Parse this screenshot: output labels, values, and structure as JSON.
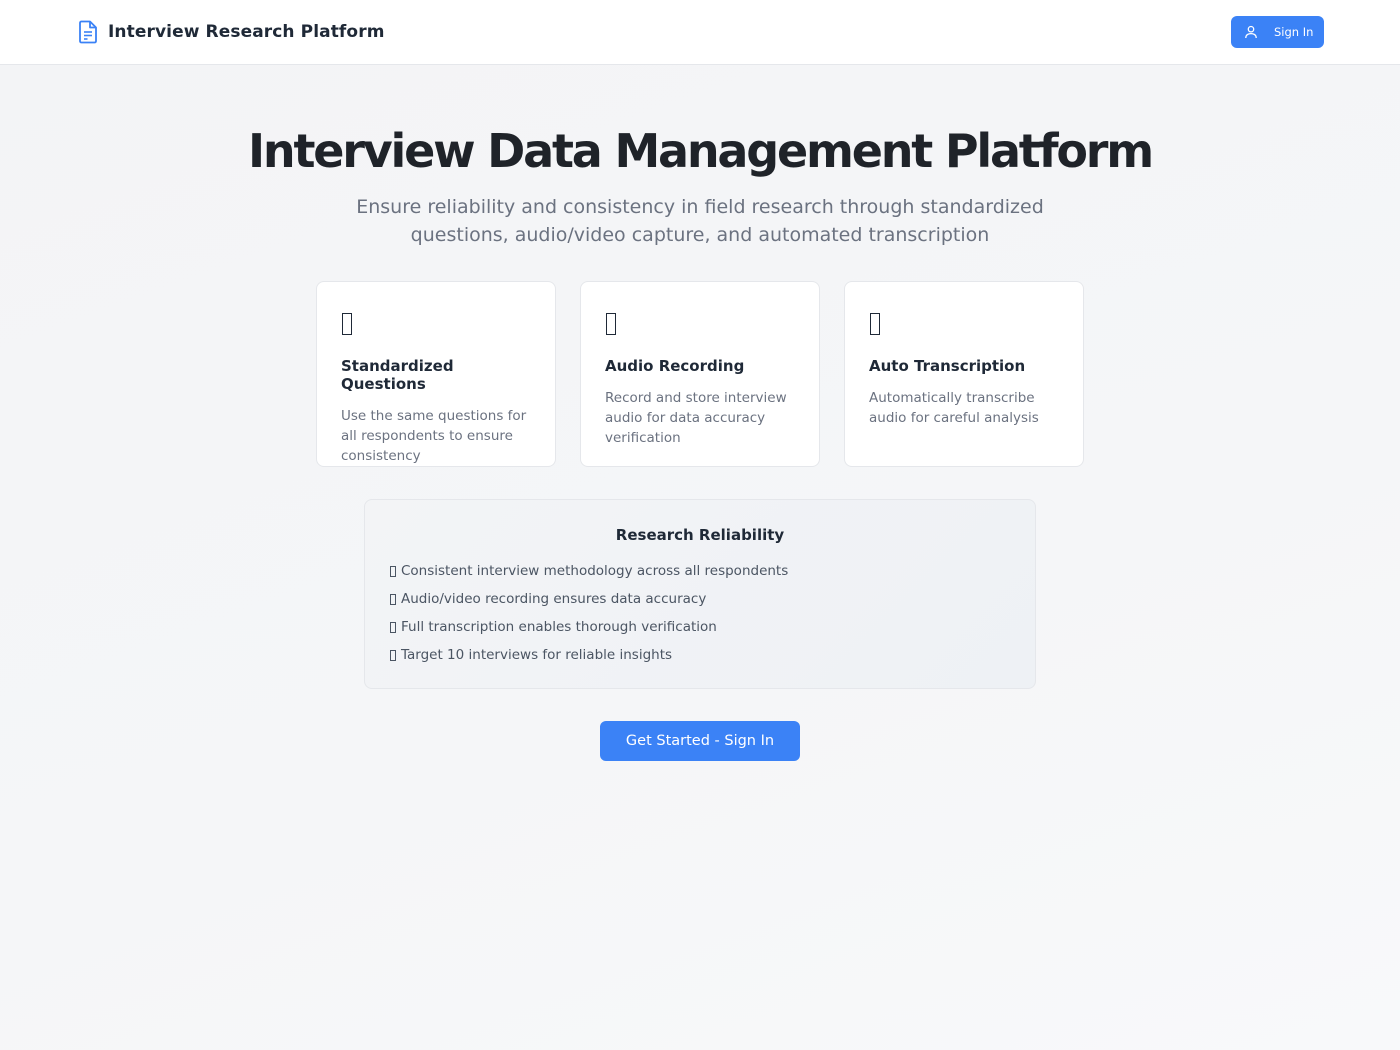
{
  "header": {
    "brand_icon": "document-icon",
    "title": "Interview Research Platform",
    "signin_icon": "user-icon",
    "signin_label": "Sign In"
  },
  "hero": {
    "title": "Interview Data Management Platform",
    "subtitle": "Ensure reliability and consistency in field research through standardized questions, audio/video capture, and automated transcription"
  },
  "features": [
    {
      "icon": "missing-glyph-icon",
      "title": "Standardized Questions",
      "description": "Use the same questions for all respondents to ensure consistency"
    },
    {
      "icon": "missing-glyph-icon",
      "title": "Audio Recording",
      "description": "Record and store interview audio for data accuracy verification"
    },
    {
      "icon": "missing-glyph-icon",
      "title": "Auto Transcription",
      "description": "Automatically transcribe audio for careful analysis"
    }
  ],
  "reliability": {
    "title": "Research Reliability",
    "items": [
      "Consistent interview methodology across all respondents",
      "Audio/video recording ensures data accuracy",
      "Full transcription enables thorough verification",
      "Target 10 interviews for reliable insights"
    ]
  },
  "cta": {
    "label": "Get Started - Sign In"
  },
  "colors": {
    "accent": "#3b82f6",
    "text": "#1f2937",
    "muted": "#6b7280"
  }
}
